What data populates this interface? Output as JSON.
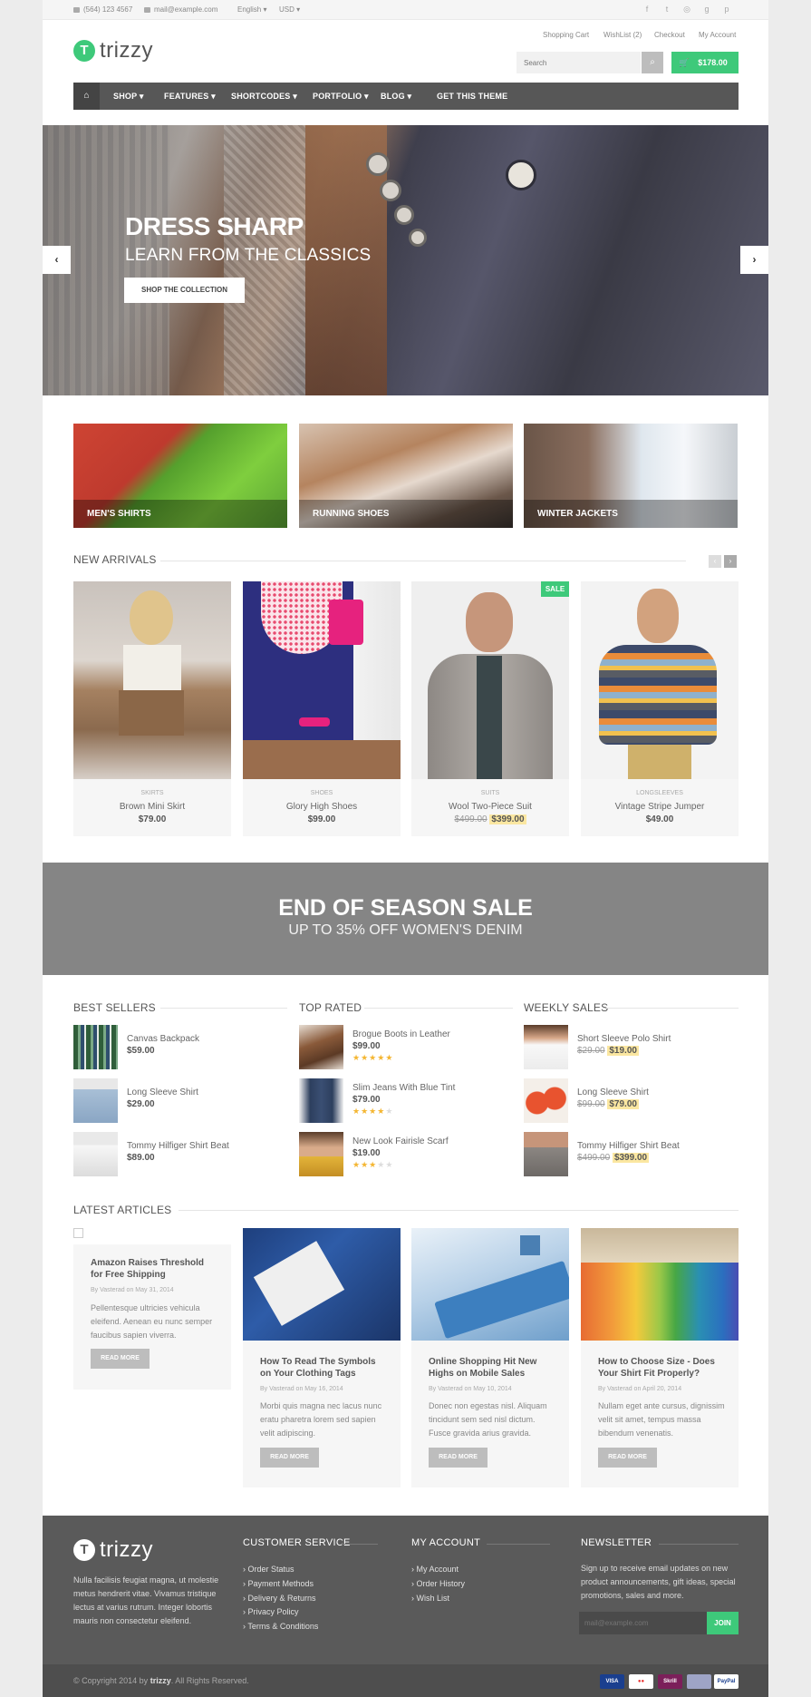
{
  "topbar": {
    "phone": "(564) 123 4567",
    "email": "mail@example.com",
    "language": "English",
    "currency": "USD"
  },
  "header": {
    "logo": "trizzy",
    "logo_mark": "T",
    "links": [
      "Shopping Cart",
      "WishList",
      "Checkout",
      "My Account"
    ],
    "wishlist_count": "(2)",
    "search_placeholder": "Search",
    "cart_total": "$178.00"
  },
  "nav": {
    "items": [
      "SHOP",
      "FEATURES",
      "SHORTCODES",
      "PORTFOLIO",
      "BLOG",
      "GET THIS THEME"
    ]
  },
  "hero": {
    "title": "DRESS SHARP",
    "subtitle": "LEARN FROM THE CLASSICS",
    "cta": "SHOP THE COLLECTION"
  },
  "categories": [
    "MEN'S SHIRTS",
    "RUNNING SHOES",
    "WINTER JACKETS"
  ],
  "new_arrivals": {
    "title": "NEW ARRIVALS",
    "sale_badge": "SALE",
    "products": [
      {
        "category": "SKIRTS",
        "name": "Brown Mini Skirt",
        "price": "$79.00"
      },
      {
        "category": "SHOES",
        "name": "Glory High Shoes",
        "price": "$99.00"
      },
      {
        "category": "SUITS",
        "name": "Wool Two-Piece Suit",
        "old_price": "$499.00",
        "price": "$399.00"
      },
      {
        "category": "LONGSLEEVES",
        "name": "Vintage Stripe Jumper",
        "price": "$49.00"
      }
    ]
  },
  "banner": {
    "title": "END OF SEASON SALE",
    "subtitle": "UP TO 35% OFF WOMEN'S DENIM"
  },
  "lists": {
    "best_sellers": {
      "title": "BEST SELLERS",
      "items": [
        {
          "name": "Canvas Backpack",
          "price": "$59.00"
        },
        {
          "name": "Long Sleeve Shirt",
          "price": "$29.00"
        },
        {
          "name": "Tommy Hilfiger Shirt Beat",
          "price": "$89.00"
        }
      ]
    },
    "top_rated": {
      "title": "TOP RATED",
      "items": [
        {
          "name": "Brogue Boots in Leather",
          "price": "$99.00",
          "rating": 5
        },
        {
          "name": "Slim Jeans With Blue Tint",
          "price": "$79.00",
          "rating": 4
        },
        {
          "name": "New Look Fairisle Scarf",
          "price": "$19.00",
          "rating": 3
        }
      ]
    },
    "weekly_sales": {
      "title": "WEEKLY SALES",
      "items": [
        {
          "name": "Short Sleeve Polo Shirt",
          "old_price": "$29.00",
          "price": "$19.00"
        },
        {
          "name": "Long Sleeve Shirt",
          "old_price": "$99.00",
          "price": "$79.00"
        },
        {
          "name": "Tommy Hilfiger Shirt Beat",
          "old_price": "$499.00",
          "price": "$399.00"
        }
      ]
    }
  },
  "articles": {
    "title": "LATEST ARTICLES",
    "read_more": "READ MORE",
    "items": [
      {
        "title": "Amazon Raises Threshold for Free Shipping",
        "meta": "By Vasterad on May 31, 2014",
        "body": "Pellentesque ultricies vehicula eleifend. Aenean eu nunc semper faucibus sapien viverra."
      },
      {
        "title": "How To Read The Symbols on Your Clothing Tags",
        "meta": "By Vasterad on May 16, 2014",
        "body": "Morbi quis magna nec lacus nunc eratu pharetra lorem sed sapien velit adipiscing."
      },
      {
        "title": "Online Shopping Hit New Highs on Mobile Sales",
        "meta": "By Vasterad on May 10, 2014",
        "body": "Donec non egestas nisl. Aliquam tincidunt sem sed nisl dictum. Fusce gravida arius gravida."
      },
      {
        "title": "How to Choose Size - Does Your Shirt Fit Properly?",
        "meta": "By Vasterad on April 20, 2014",
        "body": "Nullam eget ante cursus, dignissim velit sit amet, tempus massa bibendum venenatis."
      }
    ]
  },
  "footer": {
    "about": "Nulla facilisis feugiat magna, ut molestie metus hendrerit vitae. Vivamus tristique lectus at varius rutrum. Integer lobortis mauris non consectetur eleifend.",
    "customer_service": {
      "title": "CUSTOMER SERVICE",
      "links": [
        "Order Status",
        "Payment Methods",
        "Delivery & Returns",
        "Privacy Policy",
        "Terms & Conditions"
      ]
    },
    "my_account": {
      "title": "MY ACCOUNT",
      "links": [
        "My Account",
        "Order History",
        "Wish List"
      ]
    },
    "newsletter": {
      "title": "NEWSLETTER",
      "text": "Sign up to receive email updates on new product announcements, gift ideas, special promotions, sales and more.",
      "placeholder": "mail@example.com",
      "button": "JOIN"
    },
    "copyright_prefix": "© Copyright 2014 by",
    "copyright_brand": "trizzy",
    "copyright_suffix": ". All Rights Reserved.",
    "payments": [
      "VISA",
      "MC",
      "Skrill",
      "",
      "PayPal"
    ]
  },
  "colors": {
    "accent": "#3ec97a",
    "nav": "#575757",
    "footer": "#5a5a5a"
  }
}
